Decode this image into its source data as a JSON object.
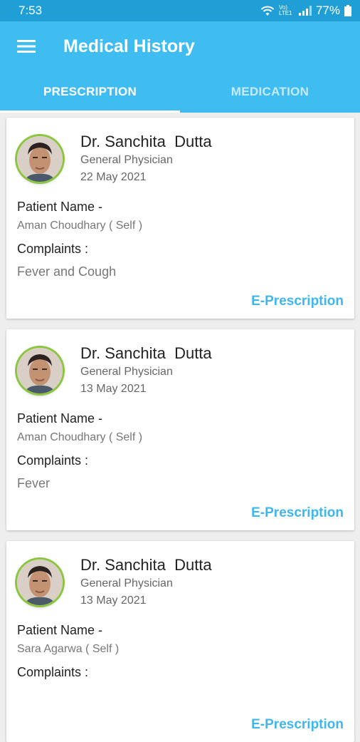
{
  "status": {
    "time": "7:53",
    "battery": "77%",
    "network": "Vo) LTE1"
  },
  "appbar": {
    "title": "Medical History",
    "menu_icon": "hamburger-menu-icon"
  },
  "tabs": [
    {
      "label": "PRESCRIPTION",
      "active": true
    },
    {
      "label": "MEDICATION",
      "active": false
    }
  ],
  "cards": [
    {
      "doctor": "Dr. Sanchita  Dutta",
      "specialty": "General Physician",
      "date": "22 May 2021",
      "patient_label": "Patient Name -",
      "patient": "Aman Choudhary ( Self )",
      "complaints_label": "Complaints :",
      "complaints": "Fever and Cough",
      "action": "E-Prescription"
    },
    {
      "doctor": "Dr. Sanchita  Dutta",
      "specialty": "General Physician",
      "date": "13 May 2021",
      "patient_label": "Patient Name -",
      "patient": "Aman Choudhary ( Self )",
      "complaints_label": "Complaints :",
      "complaints": "Fever",
      "action": "E-Prescription"
    },
    {
      "doctor": "Dr. Sanchita  Dutta",
      "specialty": "General Physician",
      "date": "13 May 2021",
      "patient_label": "Patient Name -",
      "patient": "Sara Agarwa ( Self )",
      "complaints_label": "Complaints :",
      "complaints": "",
      "action": "E-Prescription"
    }
  ],
  "colors": {
    "primary": "#3fbdf1",
    "statusbar": "#1f9fd6",
    "accent": "#3fb6ec",
    "avatar_ring": "#8cc63f"
  }
}
